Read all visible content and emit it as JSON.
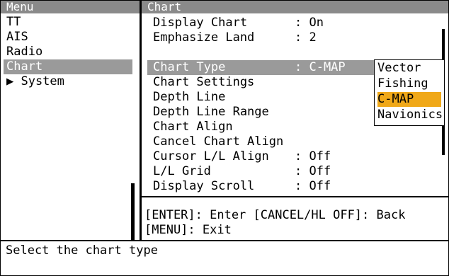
{
  "menu": {
    "header": "Menu",
    "items": [
      "TT",
      "AIS",
      "Radio",
      "Chart",
      "▶ System"
    ]
  },
  "chart": {
    "header": "Chart",
    "items": [
      {
        "label": "Display Chart",
        "value": ": On"
      },
      {
        "label": "Emphasize Land",
        "value": ": 2"
      },
      {
        "label": "Chart Type",
        "value": ": C-MAP"
      },
      {
        "label": "Chart Settings",
        "value": ""
      },
      {
        "label": "Depth Line",
        "value": ""
      },
      {
        "label": "Depth Line Range",
        "value": ""
      },
      {
        "label": "Chart Align",
        "value": ""
      },
      {
        "label": "Cancel Chart Align",
        "value": ""
      },
      {
        "label": "Cursor L/L Align",
        "value": ": Off"
      },
      {
        "label": "L/L Grid",
        "value": ": Off"
      },
      {
        "label": "Display Scroll",
        "value": ": Off"
      }
    ],
    "hint_line1": "[ENTER]: Enter [CANCEL/HL OFF]: Back",
    "hint_line2": "[MENU]: Exit"
  },
  "chart_type_options": [
    "Vector",
    "Fishing",
    "C-MAP",
    "Navionics"
  ],
  "status_text": "Select the chart type",
  "colors": {
    "highlight": "#9a9a9a",
    "option_highlight": "#f0a818"
  }
}
